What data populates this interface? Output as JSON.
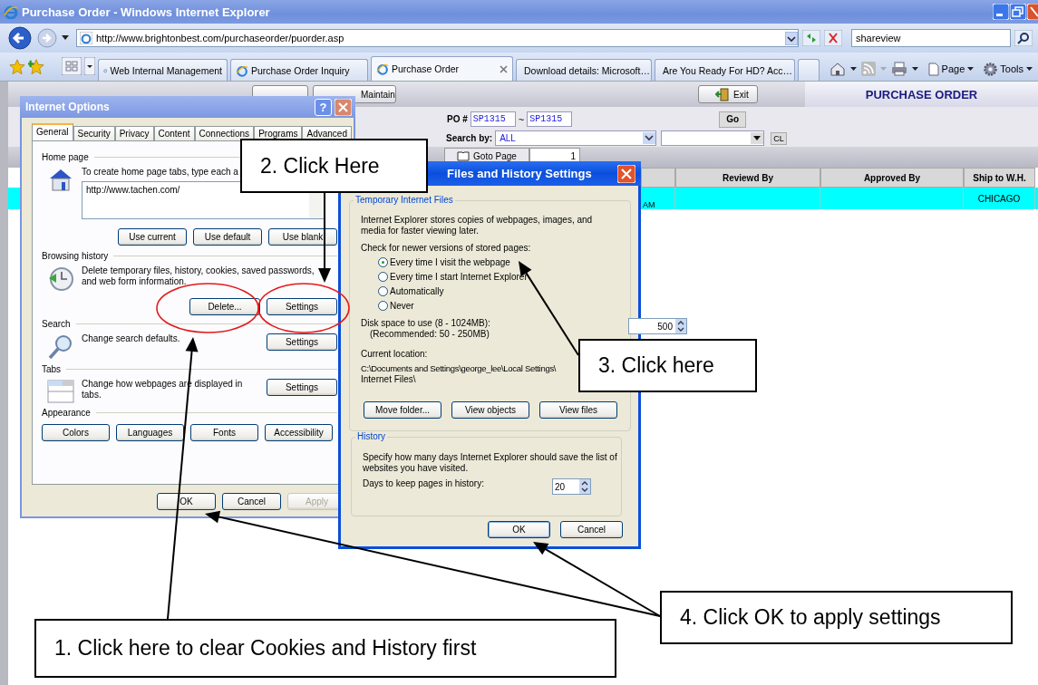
{
  "window": {
    "title": "Purchase Order - Windows Internet Explorer"
  },
  "address_bar": {
    "url": "http://www.brightonbest.com/purchaseorder/puorder.asp"
  },
  "search": {
    "value": "shareview"
  },
  "tabs": [
    {
      "label": "Web Internal Management",
      "selected": false
    },
    {
      "label": "Purchase Order Inquiry",
      "selected": false
    },
    {
      "label": "Purchase Order",
      "selected": true
    },
    {
      "label": "Download details: Microsoft…",
      "selected": false
    },
    {
      "label": "Are You Ready For HD? Acc…",
      "selected": false
    }
  ],
  "command_bar": {
    "page": "Page",
    "tools": "Tools"
  },
  "page": {
    "toolbar_buttons": [
      "Maintain",
      "Exit"
    ],
    "title": "PURCHASE ORDER",
    "po": {
      "label": "PO #",
      "from": "SP1315",
      "separator": "~",
      "to": "SP1315",
      "go": "Go"
    },
    "search": {
      "label": "Search by:",
      "value": "ALL",
      "clear": "CL"
    },
    "paging": {
      "button": "Goto Page",
      "value": "1"
    },
    "table": {
      "columns": [
        "Reviewd By",
        "Approved By",
        "Ship to W.H."
      ],
      "rows": [
        {
          "column_1": "AM",
          "ship_to": "CHICAGO"
        }
      ]
    }
  },
  "internet_options": {
    "title": "Internet Options",
    "help": "?",
    "tabs": [
      {
        "label": "General",
        "selected": true
      },
      {
        "label": "Security",
        "selected": false
      },
      {
        "label": "Privacy",
        "selected": false
      },
      {
        "label": "Content",
        "selected": false
      },
      {
        "label": "Connections",
        "selected": false
      },
      {
        "label": "Programs",
        "selected": false
      },
      {
        "label": "Advanced",
        "selected": false
      }
    ],
    "home_page": {
      "heading": "Home page",
      "text": "To create home page tabs, type each a",
      "value": "http://www.tachen.com/",
      "buttons": [
        "Use current",
        "Use default",
        "Use blank"
      ]
    },
    "sections": [
      {
        "kind": "history",
        "heading": "Browsing history",
        "text": "Delete temporary files, history, cookies, saved passwords, and web form information.",
        "buttons": [
          "Delete...",
          "Settings"
        ]
      },
      {
        "kind": "search",
        "heading": "Search",
        "text": "Change search defaults.",
        "buttons": [
          "Settings"
        ]
      },
      {
        "kind": "tabs",
        "heading": "Tabs",
        "text": "Change how webpages are displayed in tabs.",
        "buttons": [
          "Settings"
        ]
      }
    ],
    "appearance": {
      "heading": "Appearance",
      "buttons": [
        "Colors",
        "Languages",
        "Fonts",
        "Accessibility"
      ]
    },
    "footer": [
      {
        "label": "OK",
        "disabled": false
      },
      {
        "label": "Cancel",
        "disabled": false
      },
      {
        "label": "Apply",
        "disabled": true
      }
    ]
  },
  "cache_settings": {
    "title": "Files and History Settings",
    "temporary_files": {
      "heading": "Temporary Internet Files",
      "description": "Internet Explorer stores copies of webpages, images, and media for faster viewing later.",
      "check_label": "Check for newer versions of stored pages:",
      "options": [
        {
          "label": "Every time I visit the webpage",
          "selected": true
        },
        {
          "label": "Every time I start Internet Explorer",
          "selected": false
        },
        {
          "label": "Automatically",
          "selected": false
        },
        {
          "label": "Never",
          "selected": false
        }
      ],
      "disk_label": "Disk space to use (8 - 1024MB):",
      "recommended": "(Recommended: 50 - 250MB)",
      "disk_value": "500",
      "location_label": "Current location:",
      "location": [
        "C:\\Documents and Settings\\george_lee\\Local Settings\\",
        "Internet Files\\"
      ],
      "buttons": [
        "Move folder...",
        "View objects",
        "View files"
      ]
    },
    "history": {
      "heading": "History",
      "description": "Specify how many days Internet Explorer should save the list of websites you have visited.",
      "days_label": "Days to keep pages in history:",
      "days_value": "20"
    },
    "buttons": [
      "OK",
      "Cancel"
    ]
  },
  "callouts": [
    {
      "text": "2. Click Here"
    },
    {
      "text": "3. Click here"
    },
    {
      "text": "4. Click OK to apply settings"
    },
    {
      "text": "1. Click here to clear Cookies and History first"
    }
  ]
}
